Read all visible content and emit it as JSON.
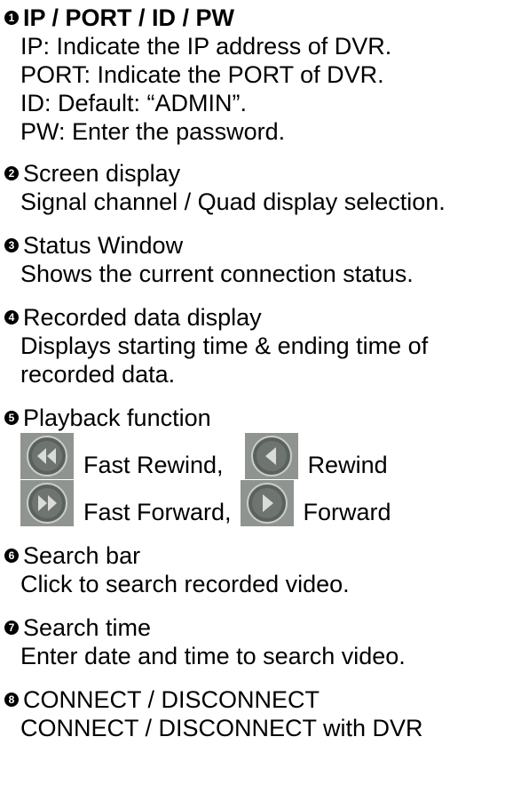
{
  "items": [
    {
      "num": "1",
      "title": "IP / PORT / ID / PW",
      "lines": [
        "IP: Indicate the IP address of DVR.",
        "PORT: Indicate the PORT of DVR.",
        "ID: Default: “ADMIN”.",
        "PW: Enter the password."
      ]
    },
    {
      "num": "2",
      "title": "Screen display",
      "lines": [
        "Signal channel / Quad display selection."
      ]
    },
    {
      "num": "3",
      "title": "Status Window",
      "lines": [
        "Shows the current connection status."
      ]
    },
    {
      "num": "4",
      "title": "Recorded data display",
      "lines": [
        "Displays starting time & ending time of",
        "recorded data."
      ]
    },
    {
      "num": "5",
      "title": "Playback function",
      "buttons": [
        {
          "label": "Fast Rewind,",
          "icon": "fast-rewind-icon"
        },
        {
          "label": "Rewind",
          "icon": "rewind-icon"
        },
        {
          "label": "Fast Forward,",
          "icon": "fast-forward-icon"
        },
        {
          "label": "Forward",
          "icon": "forward-icon"
        }
      ]
    },
    {
      "num": "6",
      "title": "Search bar",
      "lines": [
        "Click to search recorded video."
      ]
    },
    {
      "num": "7",
      "title": "Search time",
      "lines": [
        "Enter date and time to search video."
      ]
    },
    {
      "num": "8",
      "title": "CONNECT / DISCONNECT",
      "lines": [
        "CONNECT / DISCONNECT with DVR"
      ]
    }
  ]
}
